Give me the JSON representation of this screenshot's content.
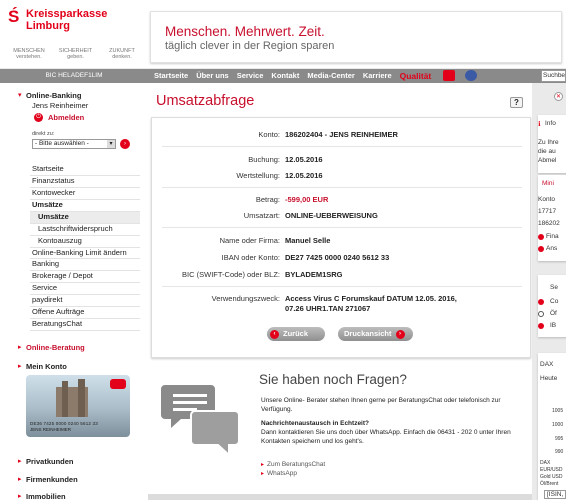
{
  "header": {
    "brand": "Kreissparkasse Limburg",
    "slogans": [
      "MENSCHEN verstehen.",
      "SICHERHEIT geben.",
      "ZUKUNFT denken."
    ],
    "banner_line1": "Menschen. Mehrwert. Zeit.",
    "banner_line2": "täglich clever in der Region sparen"
  },
  "nav": {
    "bic": "BIC HELADEF1LIM",
    "items": [
      "Startseite",
      "Über uns",
      "Service",
      "Kontakt",
      "Media-Center",
      "Karriere",
      "Qualität"
    ],
    "search_placeholder": "Suchbe"
  },
  "sidebar": {
    "online_banking": "Online-Banking",
    "user": "Jens Reinheimer",
    "abmelden": "Abmelden",
    "direkt_zu": "direkt zu:",
    "select_value": "- Bitte auswählen -",
    "menu": [
      "Startseite",
      "Finanzstatus",
      "Kontowecker",
      "Umsätze",
      "Umsätze",
      "Lastschriftwiderspruch",
      "Kontoauszug",
      "Online-Banking Limit ändern",
      "Banking",
      "Brokerage / Depot",
      "Service",
      "paydirekt",
      "Offene Aufträge",
      "BeratungsChat"
    ],
    "online_beratung": "Online-Beratung",
    "mein_konto": "Mein Konto",
    "card_number": "DE36 7425 0000 0240 5612 33",
    "card_name": "JENS REINHEIMER",
    "privatkunden": "Privatkunden",
    "firmenkunden": "Firmenkunden",
    "immobilien": "Immobilien"
  },
  "main": {
    "title": "Umsatzabfrage",
    "help": "?",
    "labels": {
      "konto": "Konto:",
      "buchung": "Buchung:",
      "wertstellung": "Wertstellung:",
      "betrag": "Betrag:",
      "umsatzart": "Umsatzart:",
      "name": "Name oder Firma:",
      "iban": "IBAN oder Konto:",
      "bic": "BIC (SWIFT-Code) oder BLZ:",
      "zweck": "Verwendungszweck:"
    },
    "values": {
      "konto": "186202404 - JENS REINHEIMER",
      "buchung": "12.05.2016",
      "wertstellung": "12.05.2016",
      "betrag": "-599,00 EUR",
      "umsatzart": "ONLINE-UEBERWEISUNG",
      "name": "Manuel Selle",
      "iban": "DE27 7425 0000 0240 5612 33",
      "bic": "BYLADEM1SRG",
      "zweck": "Access Virus C Forumskauf DATUM 12.05. 2016, 07.26 UHR1.TAN 271067"
    },
    "btn_back": "Zurück",
    "btn_print": "Druckansicht"
  },
  "questions": {
    "title": "Sie haben noch Fragen?",
    "p1": "Unsere Online- Berater stehen Ihnen gerne per BeratungsChat oder telefonisch zur Verfügung.",
    "p2_head": "Nachrichtenaustausch in Echtzeit?",
    "p2": "Dann kontaktieren Sie uns doch über WhatsApp. Einfach die 06431 - 202 0 unter Ihren Kontakten speichern und los geht's.",
    "link1": "Zum BeratungsChat",
    "link2": "WhatsApp"
  },
  "right": {
    "info": "Info",
    "t1": "Zu Ihre",
    "t2": "die au",
    "t3": "Abmel",
    "mini": "Mini",
    "konto": "Konto",
    "k1": "17717",
    "k2": "186202",
    "fin": "Fina",
    "ans": "Ans",
    "se": "Se",
    "co": "Co",
    "oe": "Öf",
    "ib": "IB",
    "dax": "DAX",
    "heute": "Heute",
    "v1": "1005",
    "v2": "1000",
    "v3": "995",
    "v4": "990",
    "dax2": "DAX",
    "eur": "EUR/USD",
    "gold": "Gold USD",
    "oel": "Öl/Brent",
    "isin": "[ISIN,"
  }
}
